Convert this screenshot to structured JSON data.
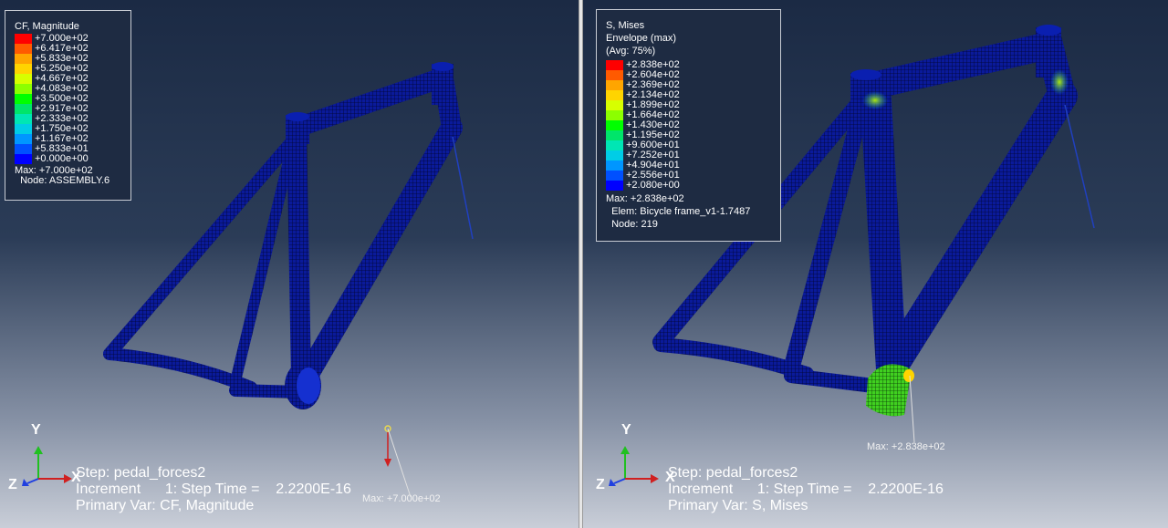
{
  "left_viewport": {
    "legend": {
      "title_lines": [
        "CF, Magnitude"
      ],
      "entries": [
        {
          "value": "+7.000e+02",
          "color": "#ff0000"
        },
        {
          "value": "+6.417e+02",
          "color": "#ff5a00"
        },
        {
          "value": "+5.833e+02",
          "color": "#ffa500"
        },
        {
          "value": "+5.250e+02",
          "color": "#ffd400"
        },
        {
          "value": "+4.667e+02",
          "color": "#d7ff00"
        },
        {
          "value": "+4.083e+02",
          "color": "#8cff00"
        },
        {
          "value": "+3.500e+02",
          "color": "#00ff00"
        },
        {
          "value": "+2.917e+02",
          "color": "#00e56a"
        },
        {
          "value": "+2.333e+02",
          "color": "#00e6b4"
        },
        {
          "value": "+1.750e+02",
          "color": "#00cde6"
        },
        {
          "value": "+1.167e+02",
          "color": "#0096ff"
        },
        {
          "value": "+5.833e+01",
          "color": "#0050ff"
        },
        {
          "value": "+0.000e+00",
          "color": "#0000ff"
        }
      ],
      "footer_lines": [
        "Max: +7.000e+02",
        "  Node: ASSEMBLY.6"
      ]
    },
    "status": {
      "line1": "Step: pedal_forces2",
      "line2": "Increment      1: Step Time =    2.2200E-16",
      "line3": "Primary Var: CF, Magnitude"
    },
    "max_label": "Max: +7.000e+02",
    "triad": {
      "x": "X",
      "y": "Y",
      "z": "Z"
    }
  },
  "right_viewport": {
    "legend": {
      "title_lines": [
        "S, Mises",
        "Envelope (max)",
        "(Avg: 75%)"
      ],
      "entries": [
        {
          "value": "+2.838e+02",
          "color": "#ff0000"
        },
        {
          "value": "+2.604e+02",
          "color": "#ff5a00"
        },
        {
          "value": "+2.369e+02",
          "color": "#ffa500"
        },
        {
          "value": "+2.134e+02",
          "color": "#ffd400"
        },
        {
          "value": "+1.899e+02",
          "color": "#d7ff00"
        },
        {
          "value": "+1.664e+02",
          "color": "#8cff00"
        },
        {
          "value": "+1.430e+02",
          "color": "#00ff00"
        },
        {
          "value": "+1.195e+02",
          "color": "#00e56a"
        },
        {
          "value": "+9.600e+01",
          "color": "#00e6b4"
        },
        {
          "value": "+7.252e+01",
          "color": "#00cde6"
        },
        {
          "value": "+4.904e+01",
          "color": "#0096ff"
        },
        {
          "value": "+2.556e+01",
          "color": "#0050ff"
        },
        {
          "value": "+2.080e+00",
          "color": "#0000ff"
        }
      ],
      "footer_lines": [
        "Max: +2.838e+02",
        "  Elem: Bicycle frame_v1-1.7487",
        "  Node: 219"
      ]
    },
    "status": {
      "line1": "Step: pedal_forces2",
      "line2": "Increment      1: Step Time =    2.2200E-16",
      "line3": "Primary Var: S, Mises"
    },
    "max_label": "Max: +2.838e+02",
    "triad": {
      "x": "X",
      "y": "Y",
      "z": "Z"
    }
  }
}
